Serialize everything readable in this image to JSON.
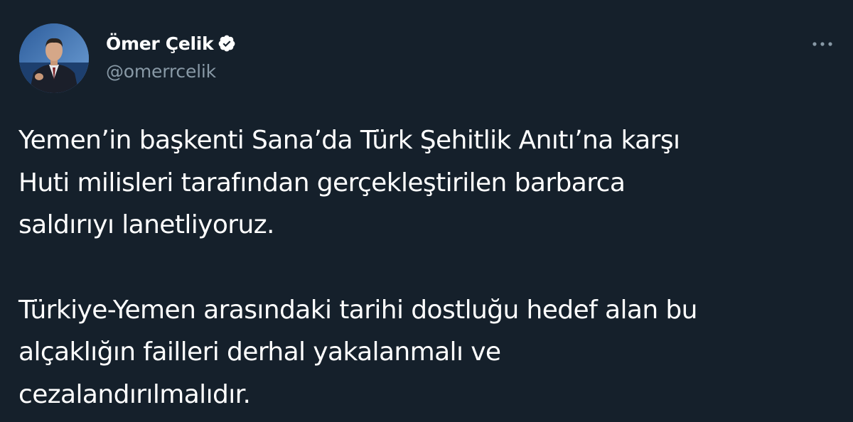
{
  "author": {
    "name": "Ömer Çelik",
    "handle": "@omerrcelik",
    "verified": true
  },
  "tweet": {
    "paragraphs": [
      "Yemen’in başkenti Sana’da Türk Şehitlik Anıtı’na karşı\nHuti milisleri tarafından gerçekleştirilen barbarca\nsaldırıyı lanetliyoruz.",
      "Türkiye-Yemen arasındaki tarihi dostluğu hedef alan bu\nalçaklığın failleri derhal yakalanmalı ve\ncezalandırılmalıdır."
    ]
  },
  "icons": {
    "verified": "verified-badge-icon",
    "more": "more-options-icon"
  },
  "colors": {
    "background": "#15202b",
    "text": "#ffffff",
    "secondary_text": "#8899a6"
  }
}
